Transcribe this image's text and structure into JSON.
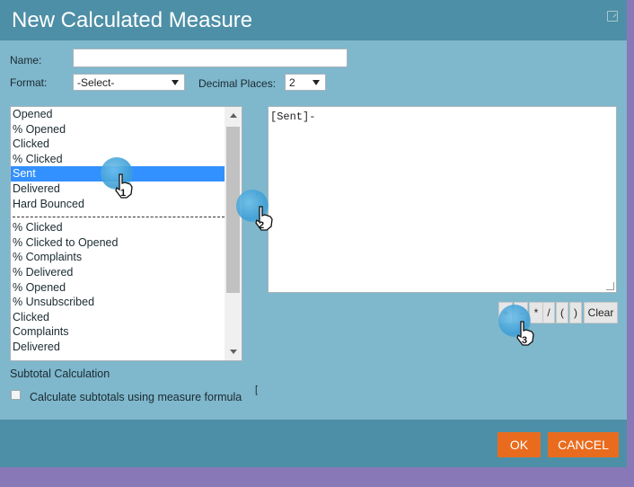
{
  "dialog": {
    "title": "New Calculated Measure"
  },
  "form": {
    "name_label": "Name:",
    "name_value": "",
    "format_label": "Format:",
    "format_value": "-Select-",
    "decimal_label": "Decimal Places:",
    "decimal_value": "2"
  },
  "measures": {
    "items": [
      "Opened",
      "% Opened",
      "Clicked",
      "% Clicked",
      "Sent",
      "Delivered",
      "Hard Bounced",
      "% Clicked",
      "% Clicked to Opened",
      "% Complaints",
      "% Delivered",
      "% Opened",
      "% Unsubscribed",
      "Clicked",
      "Complaints",
      "Delivered"
    ],
    "selected": "Sent"
  },
  "add_button": "›",
  "formula": {
    "text": "[Sent]-"
  },
  "operators": [
    "+",
    "-",
    "*",
    "/",
    "(",
    ")"
  ],
  "clear_label": "Clear",
  "subtotal": {
    "heading": "Subtotal Calculation",
    "checkbox_label": "Calculate subtotals using measure formula",
    "checked": false
  },
  "footer": {
    "ok_label": "OK",
    "cancel_label": "CANCEL"
  },
  "hints": {
    "step1": "1",
    "step2": "2",
    "step3": "3"
  },
  "colors": {
    "accent": "#e96c1e",
    "header": "#4d8fa6",
    "panel": "#7fb7cc",
    "selection": "#3390ff"
  }
}
